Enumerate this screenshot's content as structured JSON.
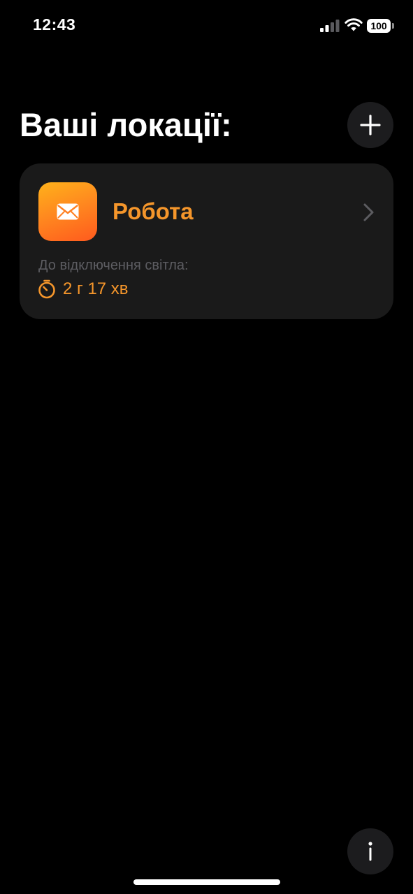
{
  "status_bar": {
    "time": "12:43",
    "battery_level": "100",
    "signal_icon": "cellular-signal-icon",
    "wifi_icon": "wifi-icon"
  },
  "header": {
    "title": "Ваші локації:",
    "add_icon": "plus-icon"
  },
  "locations": [
    {
      "name": "Робота",
      "icon": "envelope-icon",
      "outage_label": "До відключення світла:",
      "countdown": "2 г 17 хв",
      "timer_icon": "timer-icon",
      "accent_color": "#f5962b"
    }
  ],
  "footer": {
    "info_icon": "info-icon"
  },
  "colors": {
    "background": "#000000",
    "card": "#1a1a1a",
    "accent": "#f5962b",
    "muted_text": "#5d5d62",
    "button_bg": "#1c1c1e"
  }
}
